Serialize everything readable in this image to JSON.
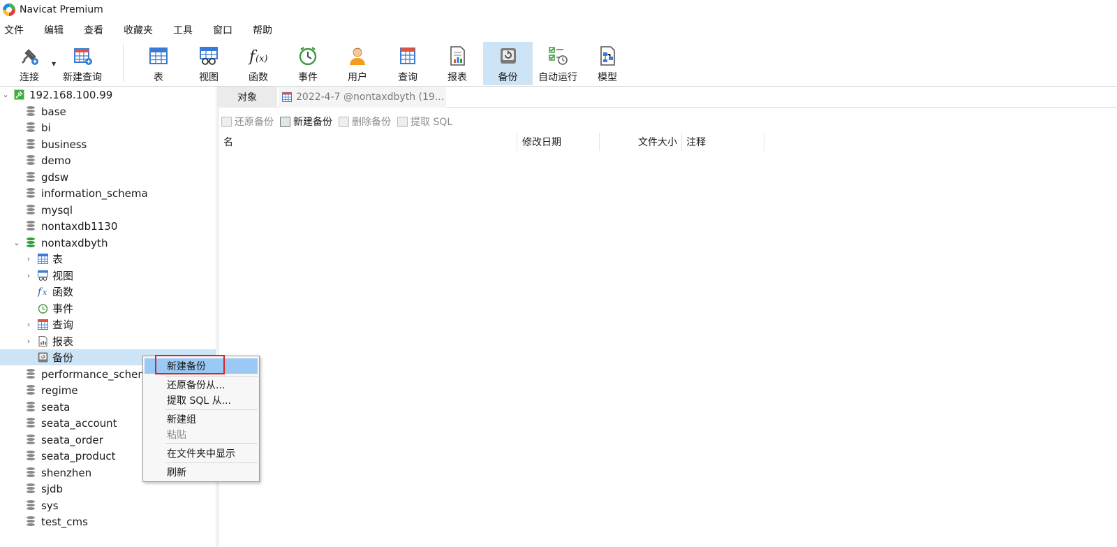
{
  "app": {
    "title": "Navicat Premium"
  },
  "menubar": {
    "items": [
      "文件",
      "编辑",
      "查看",
      "收藏夹",
      "工具",
      "窗口",
      "帮助"
    ]
  },
  "toolbar": {
    "connect": "连接",
    "new_query": "新建查询",
    "table": "表",
    "view": "视图",
    "function": "函数",
    "event": "事件",
    "user": "用户",
    "query": "查询",
    "report": "报表",
    "backup": "备份",
    "autorun": "自动运行",
    "model": "模型",
    "active": "备份"
  },
  "tree": {
    "connection": "192.168.100.99",
    "databases": [
      "base",
      "bi",
      "business",
      "demo",
      "gdsw",
      "information_schema",
      "mysql",
      "nontaxdb1130"
    ],
    "open_db": "nontaxdbyth",
    "open_db_children": [
      "表",
      "视图",
      "函数",
      "事件",
      "查询",
      "报表",
      "备份"
    ],
    "more_databases": [
      "performance_schema",
      "regime",
      "seata",
      "seata_account",
      "seata_order",
      "seata_product",
      "shenzhen",
      "sjdb",
      "sys",
      "test_cms"
    ],
    "selected": "备份"
  },
  "tabs": {
    "objects": "对象",
    "document": "2022-4-7 @nontaxdbyth (19..."
  },
  "actions": {
    "restore": "还原备份",
    "new_backup": "新建备份",
    "delete": "删除备份",
    "extract_sql": "提取 SQL"
  },
  "list": {
    "columns": [
      "名",
      "修改日期",
      "文件大小",
      "注释"
    ]
  },
  "context_menu": {
    "items": [
      "新建备份",
      "还原备份从...",
      "提取 SQL  从...",
      "新建组",
      "粘贴",
      "在文件夹中显示",
      "刷新"
    ],
    "highlighted": "新建备份",
    "disabled": [
      "粘贴"
    ]
  },
  "colors": {
    "selection": "#cde4f7",
    "menu_highlight": "#99c9f4",
    "annotation_box": "#e02020",
    "db_open": "#2e9d3a"
  }
}
